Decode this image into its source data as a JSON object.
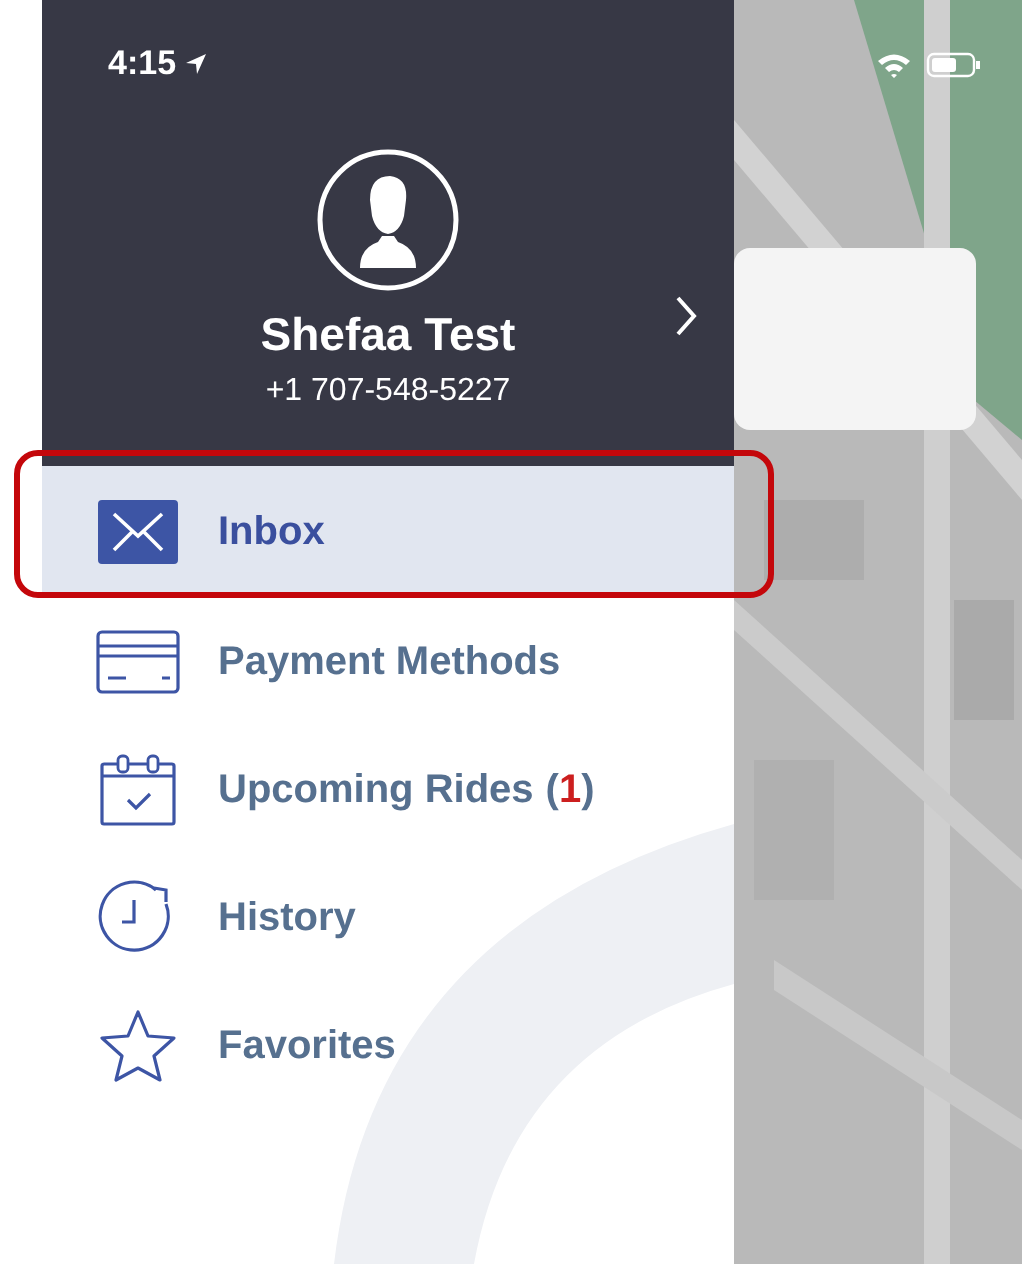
{
  "status_bar": {
    "time": "4:15"
  },
  "profile": {
    "name": "Shefaa Test",
    "phone": "+1 707-548-5227"
  },
  "menu": [
    {
      "kind": "inbox",
      "label": "Inbox",
      "selected": true
    },
    {
      "kind": "card",
      "label": "Payment Methods",
      "selected": false
    },
    {
      "kind": "calendar",
      "label": "Upcoming Rides",
      "count_prefix": "(",
      "count": "1",
      "count_suffix": ")",
      "selected": false
    },
    {
      "kind": "clock",
      "label": "History",
      "selected": false
    },
    {
      "kind": "star",
      "label": "Favorites",
      "selected": false
    }
  ]
}
